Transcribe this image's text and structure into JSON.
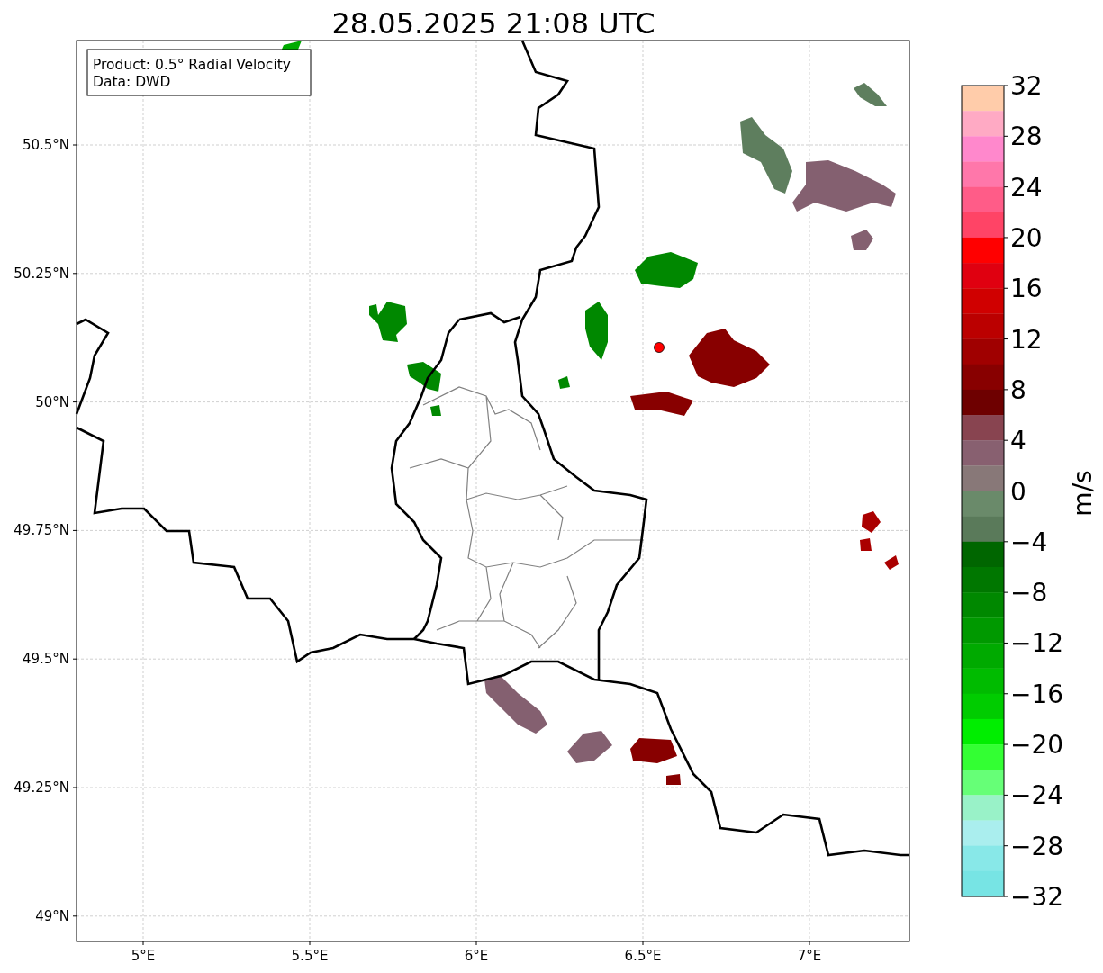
{
  "title": "28.05.2025 21:08 UTC",
  "legend": [
    "Product: 0.5° Radial Velocity",
    "Data: DWD"
  ],
  "x_ticks": [
    "5°E",
    "5.5°E",
    "6°E",
    "6.5°E",
    "7°E"
  ],
  "y_ticks": [
    "50.5°N",
    "50.25°N",
    "50°N",
    "49.75°N",
    "49.5°N",
    "49.25°N",
    "49°N"
  ],
  "colorbar": {
    "label": "m/s",
    "ticks": [
      "32",
      "28",
      "24",
      "20",
      "16",
      "12",
      "8",
      "4",
      "0",
      "−4",
      "−8",
      "−12",
      "−16",
      "−20",
      "−24",
      "−28",
      "−32"
    ],
    "bins": [
      {
        "color": "#ffccaa"
      },
      {
        "color": "#ffaac4"
      },
      {
        "color": "#ff88cc"
      },
      {
        "color": "#ff77aa"
      },
      {
        "color": "#ff5c88"
      },
      {
        "color": "#ff4466"
      },
      {
        "color": "#ff0000"
      },
      {
        "color": "#e00010"
      },
      {
        "color": "#d00000"
      },
      {
        "color": "#bb0000"
      },
      {
        "color": "#a00000"
      },
      {
        "color": "#880000"
      },
      {
        "color": "#6e0000"
      },
      {
        "color": "#884450"
      },
      {
        "color": "#886070"
      },
      {
        "color": "#887878"
      },
      {
        "color": "#6a8a6a"
      },
      {
        "color": "#5a7a5a"
      },
      {
        "color": "#006600"
      },
      {
        "color": "#007700"
      },
      {
        "color": "#008800"
      },
      {
        "color": "#009900"
      },
      {
        "color": "#00aa00"
      },
      {
        "color": "#00bb00"
      },
      {
        "color": "#00cc00"
      },
      {
        "color": "#00ee00"
      },
      {
        "color": "#33ff33"
      },
      {
        "color": "#66ff77"
      },
      {
        "color": "#99f2c8"
      },
      {
        "color": "#aaeeee"
      },
      {
        "color": "#88e8e8"
      },
      {
        "color": "#77e4e4"
      }
    ]
  }
}
